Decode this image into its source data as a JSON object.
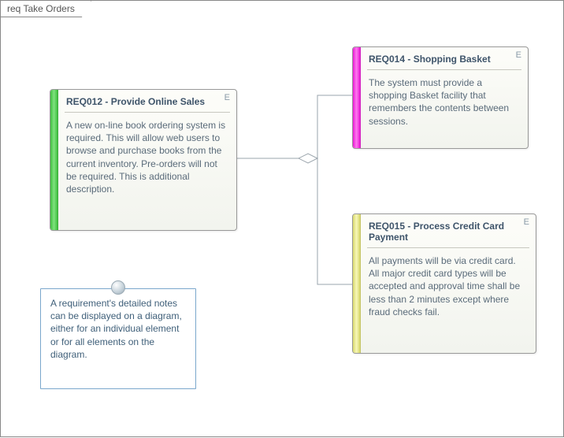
{
  "frame": {
    "title": "req Take Orders"
  },
  "reqs": {
    "r012": {
      "title": "REQ012 - Provide Online Sales",
      "e": "E",
      "text": "A new on-line book ordering system is required. This will allow web users to browse and purchase books from the current inventory. Pre-orders will not be required.  This is additional description."
    },
    "r014": {
      "title": "REQ014 - Shopping Basket",
      "e": "E",
      "text": "The system must provide a shopping Basket facility that remembers the contents between sessions."
    },
    "r015": {
      "title": "REQ015 - Process Credit Card Payment",
      "e": "E",
      "text": "All payments will be via credit card. All major credit card types will be accepted and approval time shall be less than 2 minutes except where fraud checks fail."
    }
  },
  "note": {
    "text": "A requirement's detailed notes can be displayed on a diagram, either for an individual element or for all elements on the diagram."
  }
}
